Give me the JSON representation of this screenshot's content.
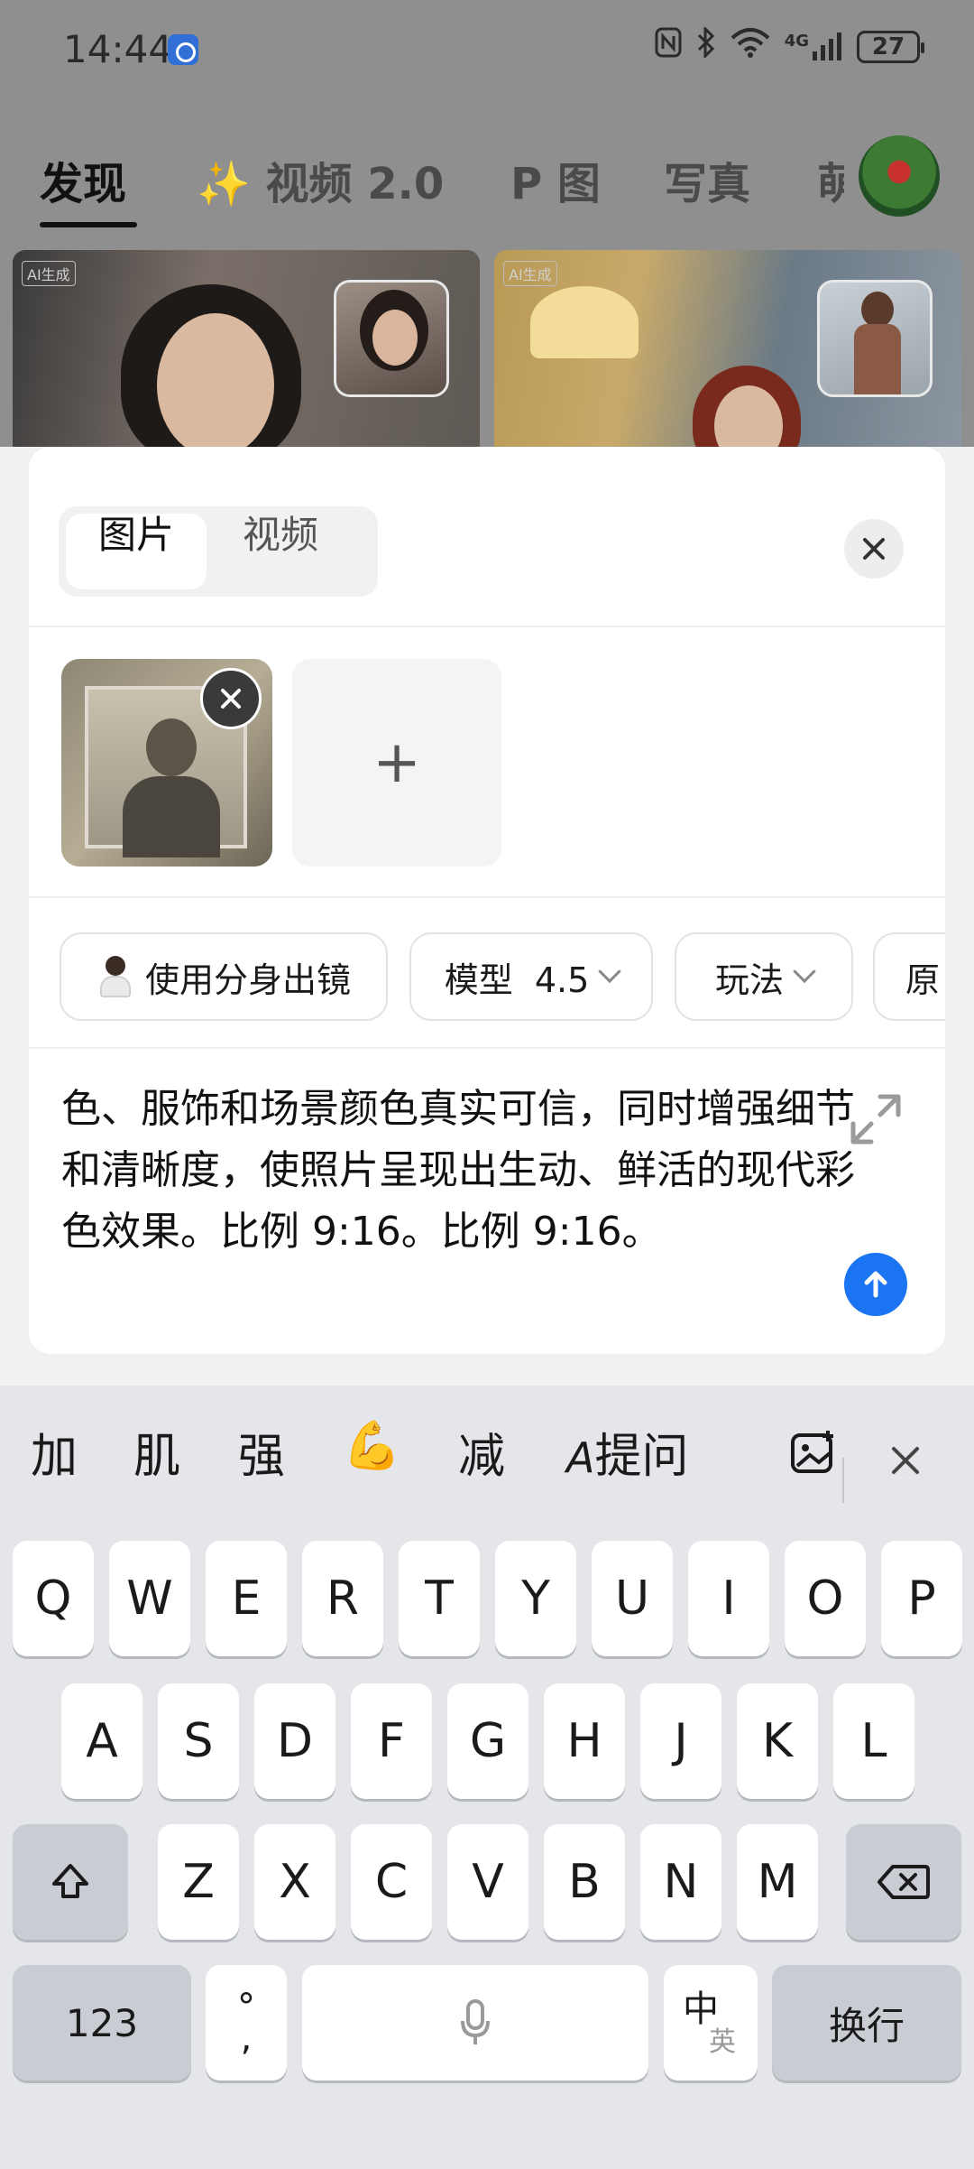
{
  "status_bar": {
    "time": "14:44",
    "icons": [
      "nfc-icon",
      "bluetooth-icon",
      "wifi-icon",
      "4g-signal-icon"
    ],
    "signal_label": "4G",
    "battery": "27"
  },
  "top_tabs": {
    "items": [
      {
        "label": "发现",
        "active": true
      },
      {
        "label": "视频 2.0",
        "sparkle": "✨"
      },
      {
        "label": "P 图"
      },
      {
        "label": "写真"
      },
      {
        "label": "萌"
      }
    ]
  },
  "cards": [
    {
      "tag": "AI生成"
    },
    {
      "tag": "AI生成"
    }
  ],
  "sheet": {
    "mode_tabs": [
      {
        "label": "图片",
        "active": true
      },
      {
        "label": "视频"
      }
    ],
    "close_icon": "close-icon",
    "add_label": "+",
    "chips": [
      {
        "label": "使用分身出镜"
      },
      {
        "label": "模型  4.5"
      },
      {
        "label": "玩法"
      },
      {
        "label": "原"
      }
    ],
    "prompt_text": "色、服饰和场景颜色真实可信，同时增强细节和清晰度，使照片呈现出生动、鲜活的现代彩色效果。比例 9:16。比例 9:16。",
    "accent_color": "#1b74f2"
  },
  "keyboard": {
    "candidates": [
      "加",
      "肌",
      "强",
      "💪",
      "减",
      "提问"
    ],
    "row1": [
      "Q",
      "W",
      "E",
      "R",
      "T",
      "Y",
      "U",
      "I",
      "O",
      "P"
    ],
    "row2": [
      "A",
      "S",
      "D",
      "F",
      "G",
      "H",
      "J",
      "K",
      "L"
    ],
    "row3": [
      "Z",
      "X",
      "C",
      "V",
      "B",
      "N",
      "M"
    ],
    "numbers_key": "123",
    "punct_key": "°\n,",
    "lang_key_main": "中",
    "lang_key_sub": "英",
    "enter_key": "换行"
  }
}
